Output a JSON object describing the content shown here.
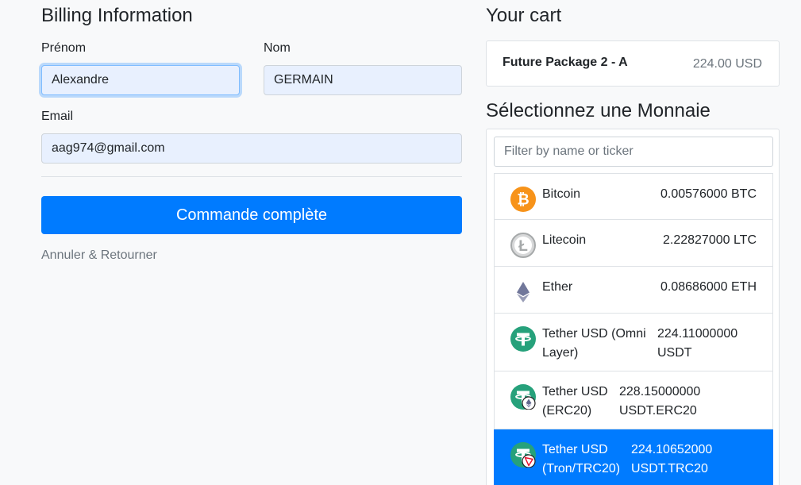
{
  "billing": {
    "title": "Billing Information",
    "first_name_label": "Prénom",
    "first_name_value": "Alexandre",
    "last_name_label": "Nom",
    "last_name_value": "GERMAIN",
    "email_label": "Email",
    "email_value": "aag974@gmail.com",
    "submit_label": "Commande complète",
    "cancel_label": "Annuler & Retourner"
  },
  "cart": {
    "title": "Your cart",
    "item_name": "Future Package 2 - A",
    "item_price": "224.00 USD"
  },
  "currency": {
    "title": "Sélectionnez une Monnaie",
    "filter_placeholder": "Filter by name or ticker",
    "coins": [
      {
        "name_lines": [
          "Bitcoin"
        ],
        "amount_lines": [
          "0.00576000 BTC"
        ],
        "icon": "bitcoin-icon",
        "color": "#f7931a"
      },
      {
        "name_lines": [
          "Litecoin"
        ],
        "amount_lines": [
          "2.22827000 LTC"
        ],
        "icon": "litecoin-icon",
        "color": "#a6a9aa"
      },
      {
        "name_lines": [
          "Ether"
        ],
        "amount_lines": [
          "0.08686000 ETH"
        ],
        "icon": "ether-icon",
        "color": "#62688f"
      },
      {
        "name_lines": [
          "Tether USD (Omni",
          "Layer)"
        ],
        "amount_lines": [
          "224.11000000",
          "USDT"
        ],
        "icon": "tether-icon",
        "color": "#26a17b"
      },
      {
        "name_lines": [
          "Tether USD",
          "(ERC20)"
        ],
        "amount_lines": [
          "228.15000000",
          "USDT.ERC20"
        ],
        "icon": "tether-erc20-icon",
        "color": "#26a17b"
      },
      {
        "name_lines": [
          "Tether USD",
          "(Tron/TRC20)"
        ],
        "amount_lines": [
          "224.10652000",
          "USDT.TRC20"
        ],
        "icon": "tether-trc20-icon",
        "color": "#26a17b",
        "selected": true
      }
    ]
  },
  "colors": {
    "primary": "#007bff",
    "input_bg": "#e8f0fe",
    "muted": "#6c757d"
  }
}
